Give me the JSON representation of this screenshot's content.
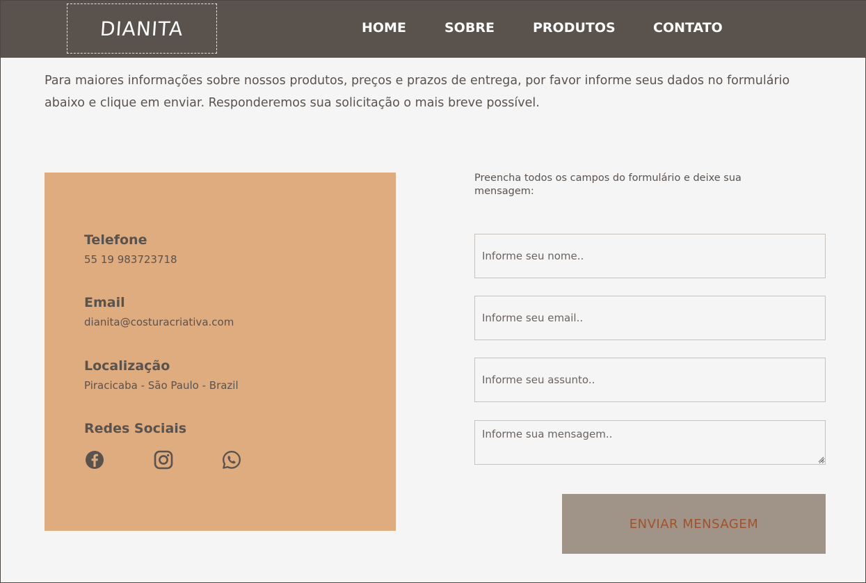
{
  "header": {
    "logo_text": "DIANITA",
    "nav": [
      {
        "label": "HOME"
      },
      {
        "label": "SOBRE"
      },
      {
        "label": "PRODUTOS"
      },
      {
        "label": "CONTATO"
      }
    ]
  },
  "intro": {
    "text": "Para maiores informações sobre nossos produtos, preços e prazos de entrega, por favor informe seus dados no formulário abaixo e clique em enviar. Responderemos sua solicitação o mais breve possível."
  },
  "contact_info": {
    "phone": {
      "title": "Telefone",
      "value": "55 19 983723718"
    },
    "email": {
      "title": "Email",
      "value": "dianita@costuracriativa.com"
    },
    "location": {
      "title": "Localização",
      "value": "Piracicaba - São Paulo - Brazil"
    },
    "social": {
      "title": "Redes Sociais",
      "icons": [
        "facebook-icon",
        "instagram-icon",
        "whatsapp-icon"
      ]
    }
  },
  "form": {
    "intro": "Preencha todos os campos do formulário e deixe sua mensagem:",
    "name_placeholder": "Informe seu nome..",
    "email_placeholder": "Informe seu email..",
    "subject_placeholder": "Informe seu assunto..",
    "message_placeholder": "Informe sua mensagem..",
    "submit_label": "ENVIAR MENSAGEM"
  },
  "colors": {
    "header_bg": "#5a524c",
    "card_bg": "#dfac80",
    "button_bg": "#a09488",
    "button_text": "#a0522d",
    "page_bg": "#f5f5f5"
  }
}
